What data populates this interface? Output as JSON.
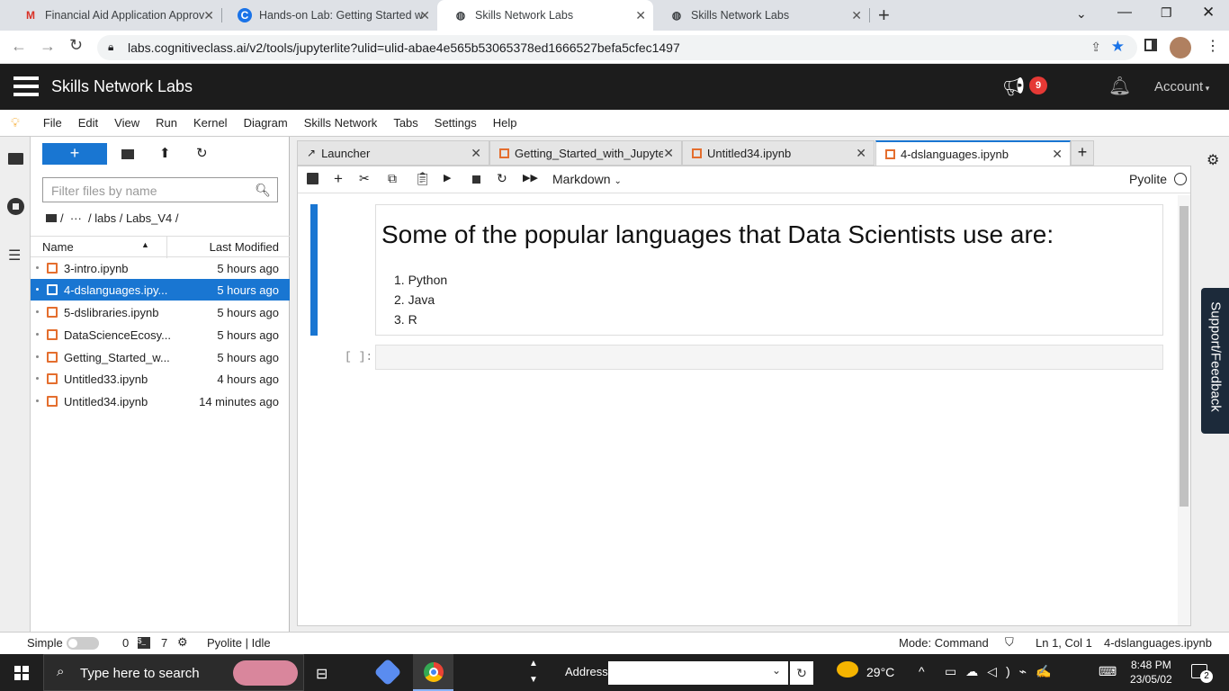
{
  "browser": {
    "tabs": [
      {
        "title": "Financial Aid Application Approv",
        "icon": "gmail-icon"
      },
      {
        "title": "Hands-on Lab: Getting Started w",
        "icon": "coursera-icon"
      },
      {
        "title": "Skills Network Labs",
        "icon": "globe-icon"
      },
      {
        "title": "Skills Network Labs",
        "icon": "globe-icon"
      }
    ],
    "url": "labs.cognitiveclass.ai/v2/tools/jupyterlite?ulid=ulid-abae4e565b53065378ed1666527befa5cfec1497"
  },
  "header": {
    "title": "Skills Network Labs",
    "badge_count": "9",
    "account_label": "Account"
  },
  "menu": [
    "File",
    "Edit",
    "View",
    "Run",
    "Kernel",
    "Diagram",
    "Skills Network",
    "Tabs",
    "Settings",
    "Help"
  ],
  "filebrowser": {
    "new_label": "+",
    "filter_placeholder": "Filter files by name",
    "breadcrumb": "/  ···  / labs / Labs_V4 /",
    "col_name": "Name",
    "col_modified": "Last Modified",
    "files": [
      {
        "name": "3-intro.ipynb",
        "modified": "5 hours ago"
      },
      {
        "name": "4-dslanguages.ipy...",
        "modified": "5 hours ago"
      },
      {
        "name": "5-dslibraries.ipynb",
        "modified": "5 hours ago"
      },
      {
        "name": "DataScienceEcosy...",
        "modified": "5 hours ago"
      },
      {
        "name": "Getting_Started_w...",
        "modified": "5 hours ago"
      },
      {
        "name": "Untitled33.ipynb",
        "modified": "4 hours ago"
      },
      {
        "name": "Untitled34.ipynb",
        "modified": "14 minutes ago"
      }
    ]
  },
  "doc_tabs": [
    {
      "label": "Launcher"
    },
    {
      "label": "Getting_Started_with_Jupyter"
    },
    {
      "label": "Untitled34.ipynb"
    },
    {
      "label": "4-dslanguages.ipynb"
    }
  ],
  "toolbar": {
    "cell_type": "Markdown",
    "kernel": "Pyolite"
  },
  "notebook": {
    "heading": "Some of the popular languages that Data Scientists use are:",
    "list": [
      "Python",
      "Java",
      "R"
    ],
    "list_nums": [
      "1.",
      "2.",
      "3."
    ],
    "empty_prompt": "[ ]:"
  },
  "support_label": "Support/Feedback",
  "status": {
    "simple": "Simple",
    "count0": "0",
    "count7": "7",
    "kernel": "Pyolite | Idle",
    "mode": "Mode: Command",
    "position": "Ln 1, Col 1",
    "file": "4-dslanguages.ipynb"
  },
  "taskbar": {
    "search": "Type here to search",
    "address_label": "Address",
    "temp": "29°C",
    "time": "8:48 PM",
    "date": "23/05/02",
    "notif_count": "2"
  }
}
